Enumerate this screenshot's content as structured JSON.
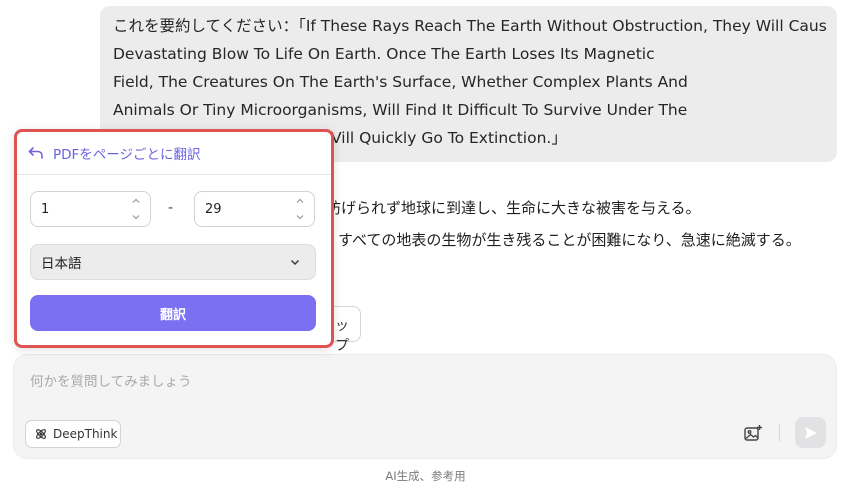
{
  "user_message": {
    "lines": [
      "これを要約してください：「If These Rays Reach The Earth Without Obstruction, They Will Cause A",
      "Devastating Blow To Life On Earth. Once The Earth Loses Its Magnetic",
      "Field, The Creatures On The Earth's Surface, Whether Complex Plants And",
      "Animals Or Tiny Microorganisms, Will Find It Difficult To Survive Under The",
      "Vill Quickly Go To Extinction.」"
    ]
  },
  "response": {
    "line1": "防げられず地球に到達し、生命に大きな被害を与える。",
    "line2": "すべての地表の生物が生き残ることが困難になり、急速に絶滅する。",
    "partial_button": "ップ"
  },
  "translate_popup": {
    "title": "PDFをページごとに翻訳",
    "from_page": "1",
    "to_page": "29",
    "dash": "-",
    "language": "日本語",
    "translate_label": "翻訳"
  },
  "composer": {
    "placeholder": "何かを質問してみましょう",
    "deepthink_label": "DeepThink"
  },
  "footer_note": "AI生成、参考用",
  "colors": {
    "accent": "#7b70f2",
    "highlight_border": "#e05353",
    "bubble_bg": "#ececec"
  }
}
